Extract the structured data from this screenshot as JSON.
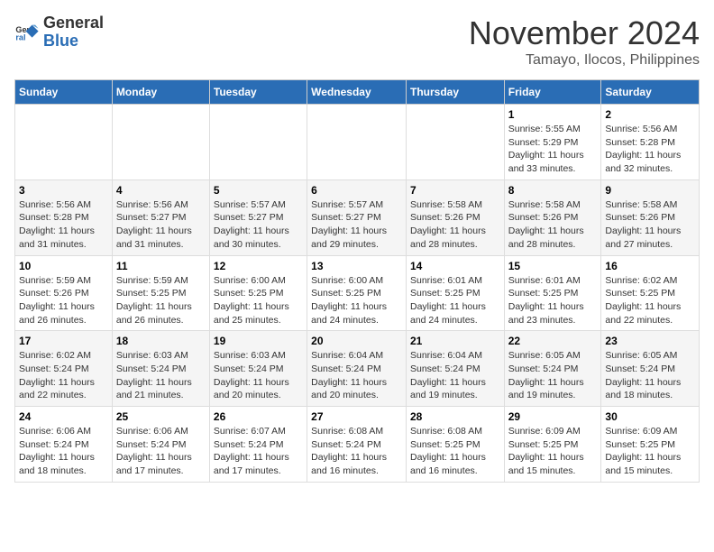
{
  "logo": {
    "general": "General",
    "blue": "Blue"
  },
  "title": {
    "month": "November 2024",
    "location": "Tamayo, Ilocos, Philippines"
  },
  "headers": [
    "Sunday",
    "Monday",
    "Tuesday",
    "Wednesday",
    "Thursday",
    "Friday",
    "Saturday"
  ],
  "weeks": [
    [
      {
        "day": "",
        "info": ""
      },
      {
        "day": "",
        "info": ""
      },
      {
        "day": "",
        "info": ""
      },
      {
        "day": "",
        "info": ""
      },
      {
        "day": "",
        "info": ""
      },
      {
        "day": "1",
        "info": "Sunrise: 5:55 AM\nSunset: 5:29 PM\nDaylight: 11 hours and 33 minutes."
      },
      {
        "day": "2",
        "info": "Sunrise: 5:56 AM\nSunset: 5:28 PM\nDaylight: 11 hours and 32 minutes."
      }
    ],
    [
      {
        "day": "3",
        "info": "Sunrise: 5:56 AM\nSunset: 5:28 PM\nDaylight: 11 hours and 31 minutes."
      },
      {
        "day": "4",
        "info": "Sunrise: 5:56 AM\nSunset: 5:27 PM\nDaylight: 11 hours and 31 minutes."
      },
      {
        "day": "5",
        "info": "Sunrise: 5:57 AM\nSunset: 5:27 PM\nDaylight: 11 hours and 30 minutes."
      },
      {
        "day": "6",
        "info": "Sunrise: 5:57 AM\nSunset: 5:27 PM\nDaylight: 11 hours and 29 minutes."
      },
      {
        "day": "7",
        "info": "Sunrise: 5:58 AM\nSunset: 5:26 PM\nDaylight: 11 hours and 28 minutes."
      },
      {
        "day": "8",
        "info": "Sunrise: 5:58 AM\nSunset: 5:26 PM\nDaylight: 11 hours and 28 minutes."
      },
      {
        "day": "9",
        "info": "Sunrise: 5:58 AM\nSunset: 5:26 PM\nDaylight: 11 hours and 27 minutes."
      }
    ],
    [
      {
        "day": "10",
        "info": "Sunrise: 5:59 AM\nSunset: 5:26 PM\nDaylight: 11 hours and 26 minutes."
      },
      {
        "day": "11",
        "info": "Sunrise: 5:59 AM\nSunset: 5:25 PM\nDaylight: 11 hours and 26 minutes."
      },
      {
        "day": "12",
        "info": "Sunrise: 6:00 AM\nSunset: 5:25 PM\nDaylight: 11 hours and 25 minutes."
      },
      {
        "day": "13",
        "info": "Sunrise: 6:00 AM\nSunset: 5:25 PM\nDaylight: 11 hours and 24 minutes."
      },
      {
        "day": "14",
        "info": "Sunrise: 6:01 AM\nSunset: 5:25 PM\nDaylight: 11 hours and 24 minutes."
      },
      {
        "day": "15",
        "info": "Sunrise: 6:01 AM\nSunset: 5:25 PM\nDaylight: 11 hours and 23 minutes."
      },
      {
        "day": "16",
        "info": "Sunrise: 6:02 AM\nSunset: 5:25 PM\nDaylight: 11 hours and 22 minutes."
      }
    ],
    [
      {
        "day": "17",
        "info": "Sunrise: 6:02 AM\nSunset: 5:24 PM\nDaylight: 11 hours and 22 minutes."
      },
      {
        "day": "18",
        "info": "Sunrise: 6:03 AM\nSunset: 5:24 PM\nDaylight: 11 hours and 21 minutes."
      },
      {
        "day": "19",
        "info": "Sunrise: 6:03 AM\nSunset: 5:24 PM\nDaylight: 11 hours and 20 minutes."
      },
      {
        "day": "20",
        "info": "Sunrise: 6:04 AM\nSunset: 5:24 PM\nDaylight: 11 hours and 20 minutes."
      },
      {
        "day": "21",
        "info": "Sunrise: 6:04 AM\nSunset: 5:24 PM\nDaylight: 11 hours and 19 minutes."
      },
      {
        "day": "22",
        "info": "Sunrise: 6:05 AM\nSunset: 5:24 PM\nDaylight: 11 hours and 19 minutes."
      },
      {
        "day": "23",
        "info": "Sunrise: 6:05 AM\nSunset: 5:24 PM\nDaylight: 11 hours and 18 minutes."
      }
    ],
    [
      {
        "day": "24",
        "info": "Sunrise: 6:06 AM\nSunset: 5:24 PM\nDaylight: 11 hours and 18 minutes."
      },
      {
        "day": "25",
        "info": "Sunrise: 6:06 AM\nSunset: 5:24 PM\nDaylight: 11 hours and 17 minutes."
      },
      {
        "day": "26",
        "info": "Sunrise: 6:07 AM\nSunset: 5:24 PM\nDaylight: 11 hours and 17 minutes."
      },
      {
        "day": "27",
        "info": "Sunrise: 6:08 AM\nSunset: 5:24 PM\nDaylight: 11 hours and 16 minutes."
      },
      {
        "day": "28",
        "info": "Sunrise: 6:08 AM\nSunset: 5:25 PM\nDaylight: 11 hours and 16 minutes."
      },
      {
        "day": "29",
        "info": "Sunrise: 6:09 AM\nSunset: 5:25 PM\nDaylight: 11 hours and 15 minutes."
      },
      {
        "day": "30",
        "info": "Sunrise: 6:09 AM\nSunset: 5:25 PM\nDaylight: 11 hours and 15 minutes."
      }
    ]
  ]
}
